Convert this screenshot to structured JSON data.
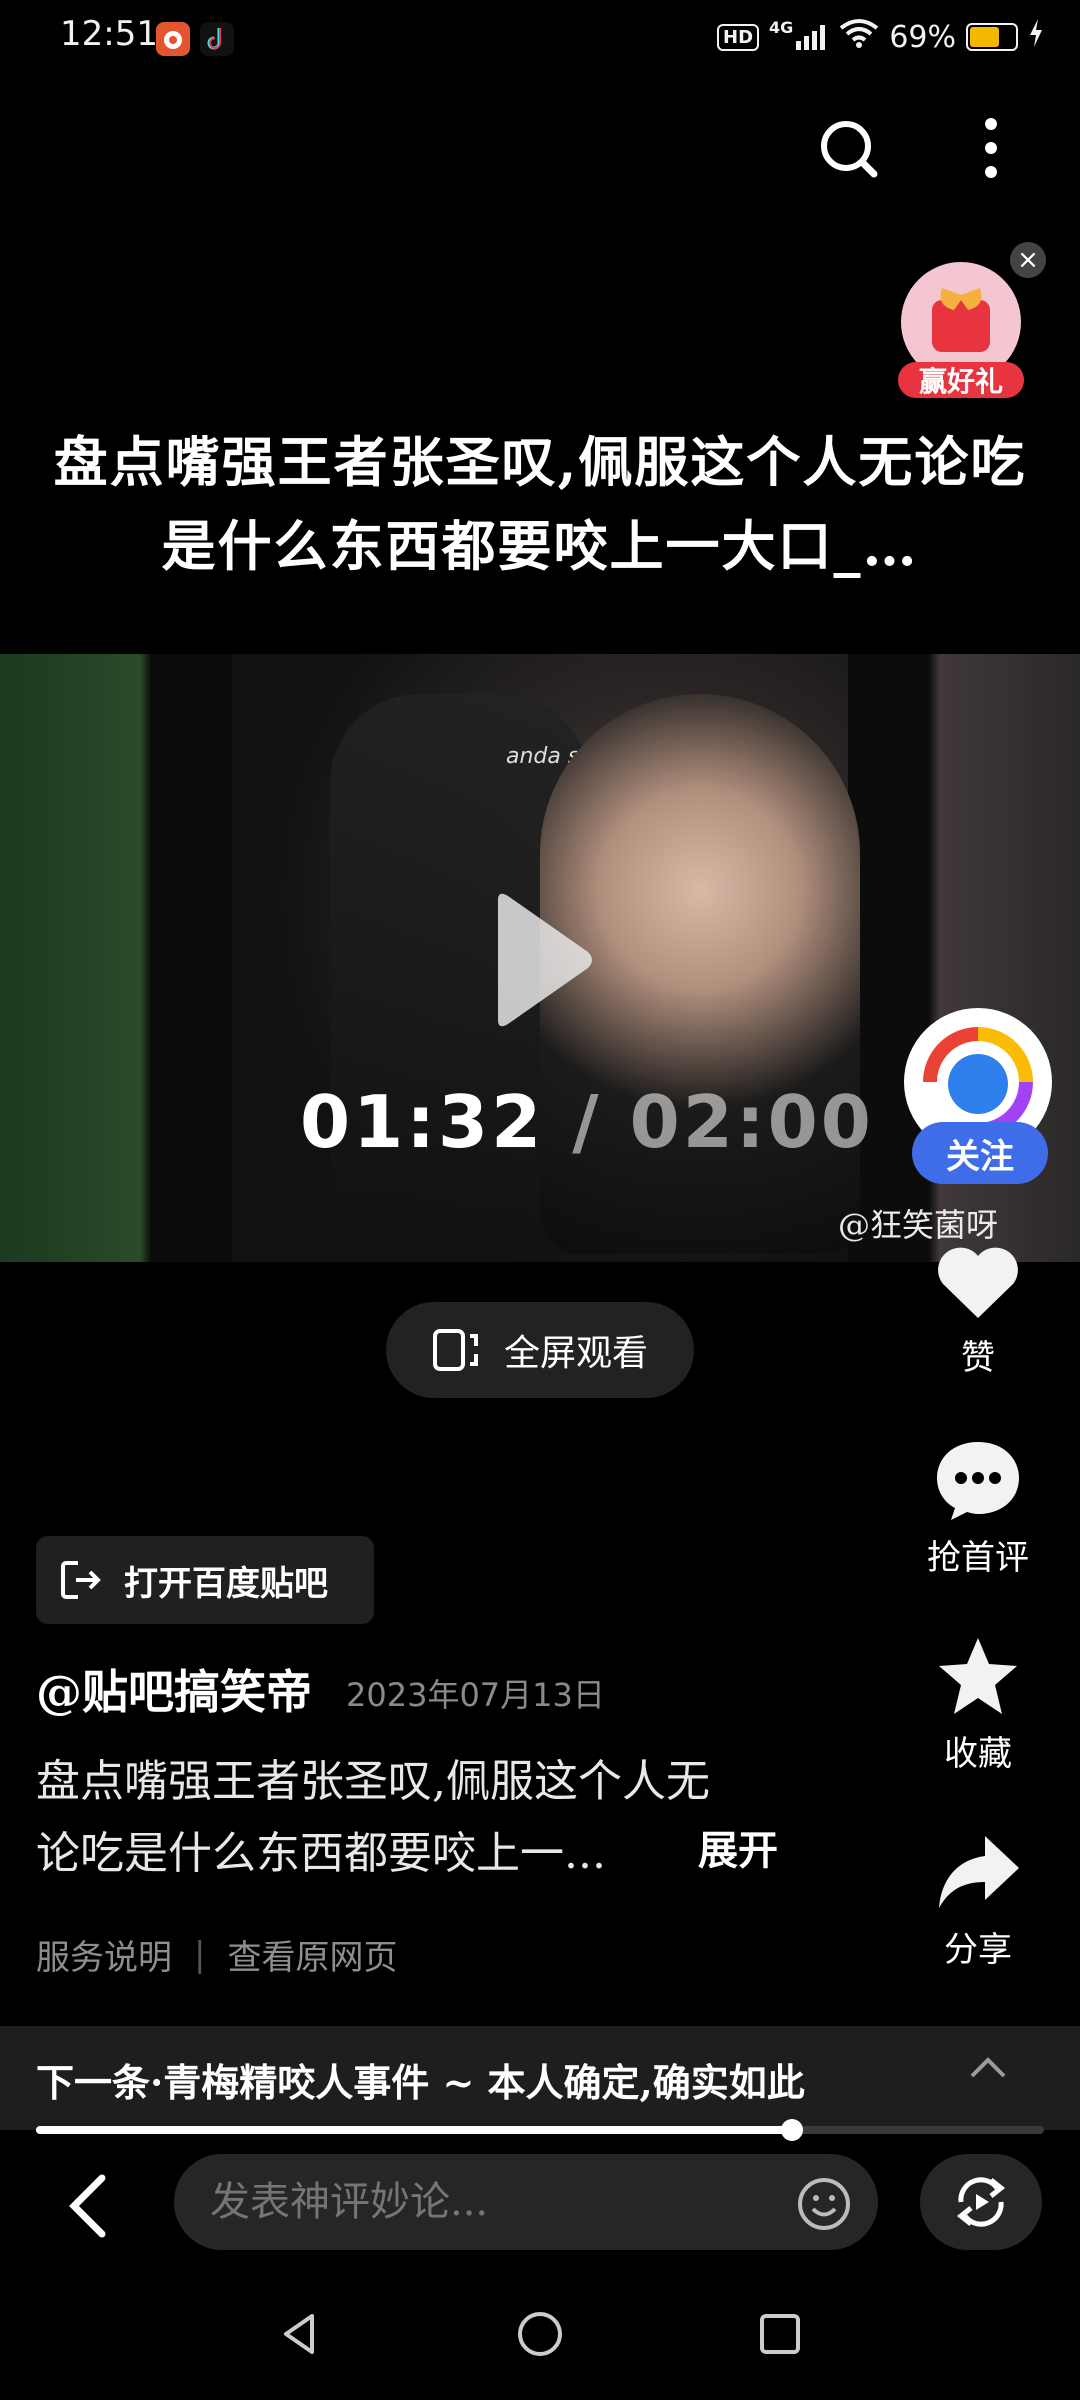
{
  "status_bar": {
    "time": "12:51",
    "network": "4G",
    "battery_percent": "69%",
    "battery_level": 0.69,
    "icons": [
      "weibo-icon",
      "douyin-icon",
      "hd-icon",
      "signal-icon",
      "wifi-icon",
      "battery-icon",
      "charging-icon"
    ]
  },
  "header": {
    "icons": [
      "search-icon",
      "more-vertical-icon"
    ]
  },
  "prize_badge": {
    "label": "赢好礼"
  },
  "video": {
    "title": "盘点嘴强王者张圣叹,佩服这个人无论吃是什么东西都要咬上一大口_…",
    "watermark": "anda se",
    "current_time": "01:32",
    "separator": "/",
    "total_time": "02:00",
    "fullscreen_label": "全屏观看"
  },
  "author": {
    "follow_label": "关注",
    "handle": "@狂笑菌呀"
  },
  "actions": {
    "like_label": "赞",
    "comment_label": "抢首评",
    "favorite_label": "收藏",
    "share_label": "分享"
  },
  "post": {
    "open_app_label": "打开百度贴吧",
    "poster": "@贴吧搞笑帝",
    "date": "2023年07月13日",
    "description_line1": "盘点嘴强王者张圣叹,佩服这个人无",
    "description_line2": "论吃是什么东西都要咬上一...",
    "expand_label": "展开",
    "service_label": "服务说明",
    "link_separator": "|",
    "source_label": "查看原网页"
  },
  "next": {
    "label": "下一条·青梅精咬人事件 ~ 本人确定,确实如此",
    "progress": 0.75
  },
  "comment_bar": {
    "placeholder": "发表神评妙论..."
  },
  "colors": {
    "background": "#000000",
    "follow_button": "#3f6ce8",
    "battery": "#f5b800",
    "muted_text": "#8a8a8a"
  }
}
